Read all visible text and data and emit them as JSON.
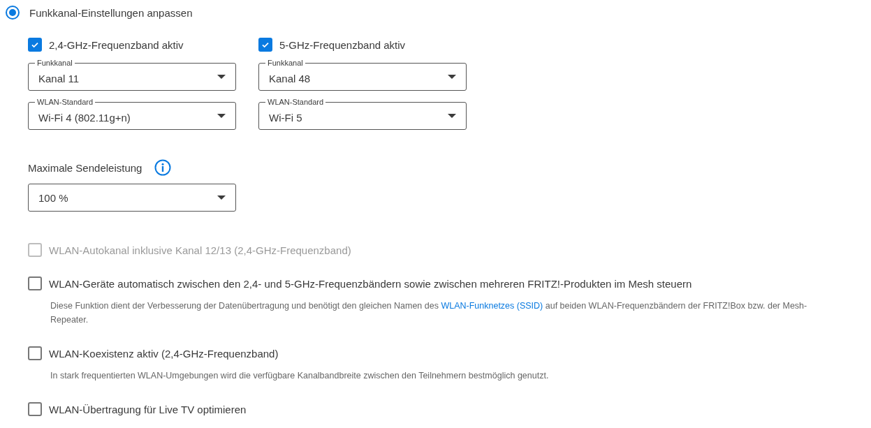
{
  "mode": {
    "label": "Funkkanal-Einstellungen anpassen",
    "selected": true
  },
  "bands": [
    {
      "label": "2,4-GHz-Frequenzband aktiv",
      "checked": true,
      "selects": [
        {
          "label": "Funkkanal",
          "value": "Kanal 11"
        },
        {
          "label": "WLAN-Standard",
          "value": "Wi-Fi 4 (802.11g+n)"
        }
      ]
    },
    {
      "label": "5-GHz-Frequenzband aktiv",
      "checked": true,
      "selects": [
        {
          "label": "Funkkanal",
          "value": "Kanal 48"
        },
        {
          "label": "WLAN-Standard",
          "value": "Wi-Fi 5"
        }
      ]
    }
  ],
  "power": {
    "label": "Maximale Sendeleistung",
    "value": "100 %"
  },
  "options": [
    {
      "label": "WLAN-Autokanal inklusive Kanal 12/13 (2,4-GHz-Frequenzband)",
      "checked": false,
      "disabled": true
    },
    {
      "label": "WLAN-Geräte automatisch zwischen den 2,4- und 5-GHz-Frequenzbändern sowie zwischen mehreren FRITZ!-Produkten im Mesh steuern",
      "checked": false,
      "disabled": false,
      "description": {
        "before": "Diese Funktion dient der Verbesserung der Datenübertragung und benötigt den gleichen Namen des ",
        "link": "WLAN-Funknetzes (SSID)",
        "after": " auf beiden WLAN-Frequenzbändern der FRITZ!Box bzw. der Mesh-Repeater."
      }
    },
    {
      "label": "WLAN-Koexistenz aktiv (2,4-GHz-Frequenzband)",
      "checked": false,
      "disabled": false,
      "description": {
        "before": "In stark frequentierten WLAN-Umgebungen wird die verfügbare Kanalbandbreite zwischen den Teilnehmern bestmöglich genutzt."
      }
    },
    {
      "label": "WLAN-Übertragung für Live TV optimieren",
      "checked": false,
      "disabled": false
    }
  ]
}
